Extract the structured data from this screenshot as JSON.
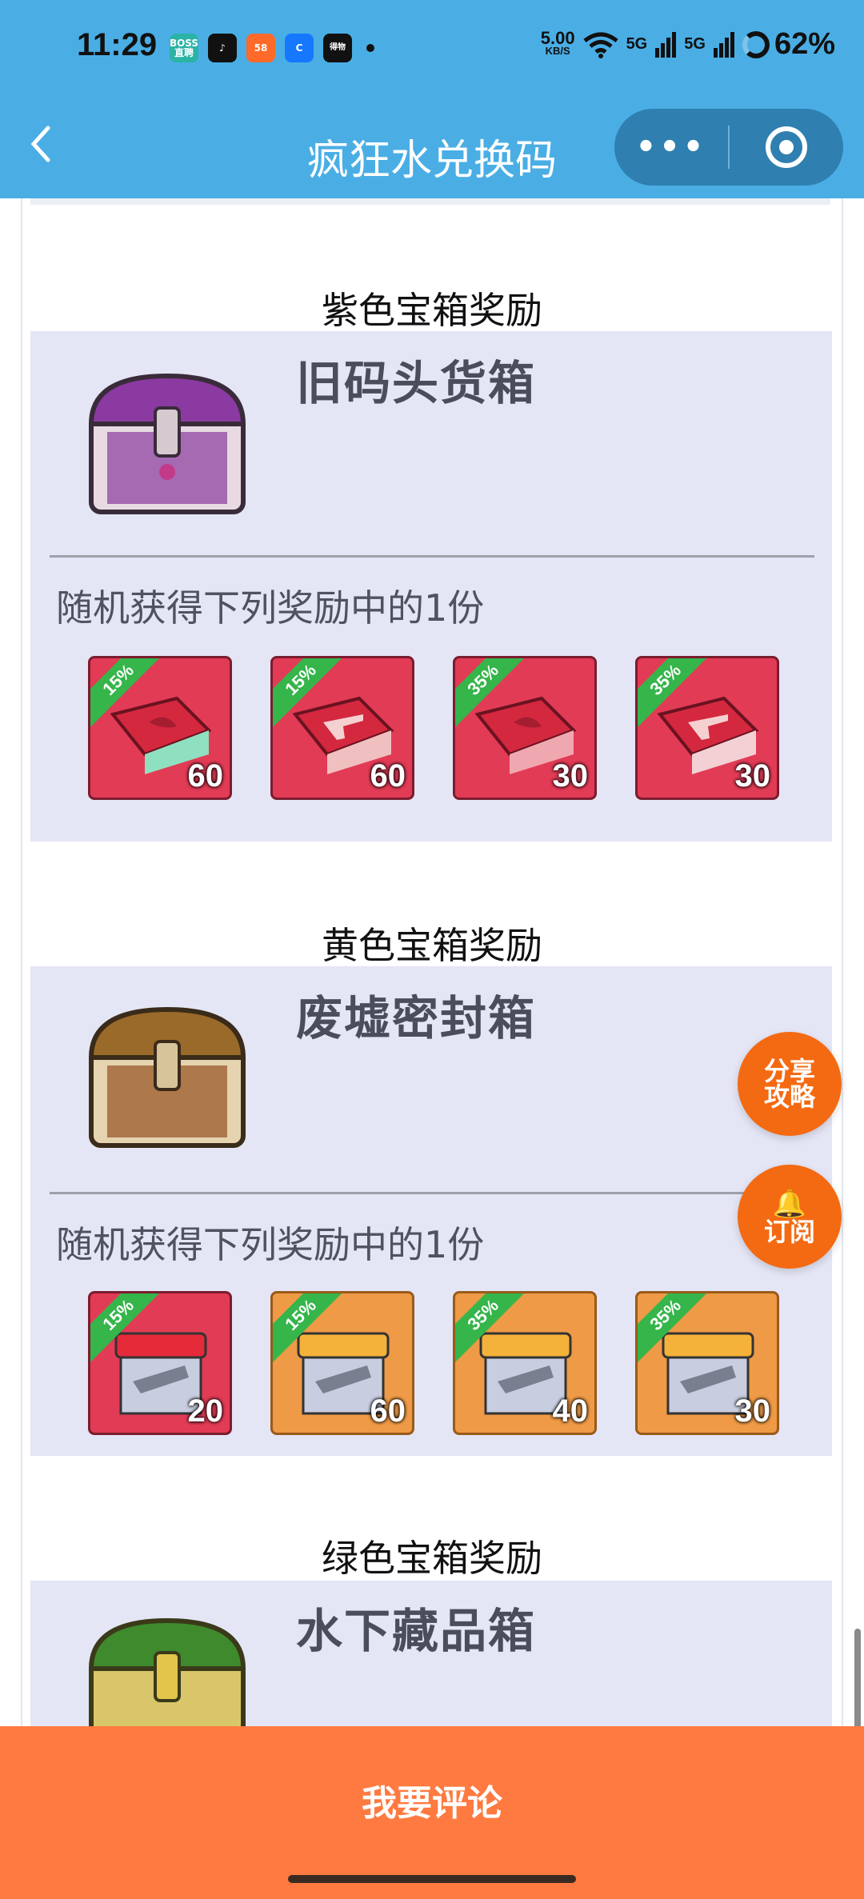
{
  "status_bar": {
    "time": "11:29",
    "app_icons": [
      {
        "name": "boss-app-icon",
        "label": "BOSS\n直聘",
        "color": "#2bb3a5"
      },
      {
        "name": "tiktok-app-icon",
        "label": "♪",
        "color": "#111111"
      },
      {
        "name": "58-app-icon",
        "label": "58",
        "color": "#ff6a2a"
      },
      {
        "name": "c-app-icon",
        "label": "C",
        "color": "#1677ff"
      },
      {
        "name": "wuliu-app-icon",
        "label": "得物",
        "color": "#111111"
      }
    ],
    "net_speed": "5.00",
    "net_unit": "KB/S",
    "signal1": "5G",
    "signal2": "5G",
    "battery": "62%"
  },
  "nav": {
    "title": "疯狂水兑换码",
    "more_label": "•••"
  },
  "sections": [
    {
      "title": "紫色宝箱奖励",
      "chest_name": "旧码头货箱",
      "random_text": "随机获得下列奖励中的1份",
      "chest_color": "#8a3aa0",
      "items": [
        {
          "percent": "15%",
          "count": "60",
          "style": "red"
        },
        {
          "percent": "15%",
          "count": "60",
          "style": "red"
        },
        {
          "percent": "35%",
          "count": "30",
          "style": "red"
        },
        {
          "percent": "35%",
          "count": "30",
          "style": "red"
        }
      ]
    },
    {
      "title": "黄色宝箱奖励",
      "chest_name": "废墟密封箱",
      "random_text": "随机获得下列奖励中的1份",
      "chest_color": "#9a6a2a",
      "items": [
        {
          "percent": "15%",
          "count": "20",
          "style": "red"
        },
        {
          "percent": "15%",
          "count": "60",
          "style": "orange"
        },
        {
          "percent": "35%",
          "count": "40",
          "style": "orange"
        },
        {
          "percent": "35%",
          "count": "30",
          "style": "orange"
        }
      ]
    },
    {
      "title": "绿色宝箱奖励",
      "chest_name": "水下藏品箱",
      "chest_color": "#3f8a2c"
    }
  ],
  "fab": {
    "share_line1": "分享",
    "share_line2": "攻略",
    "subscribe_icon": "🔔",
    "subscribe_label": "订阅"
  },
  "bottom": {
    "comment_label": "我要评论"
  }
}
